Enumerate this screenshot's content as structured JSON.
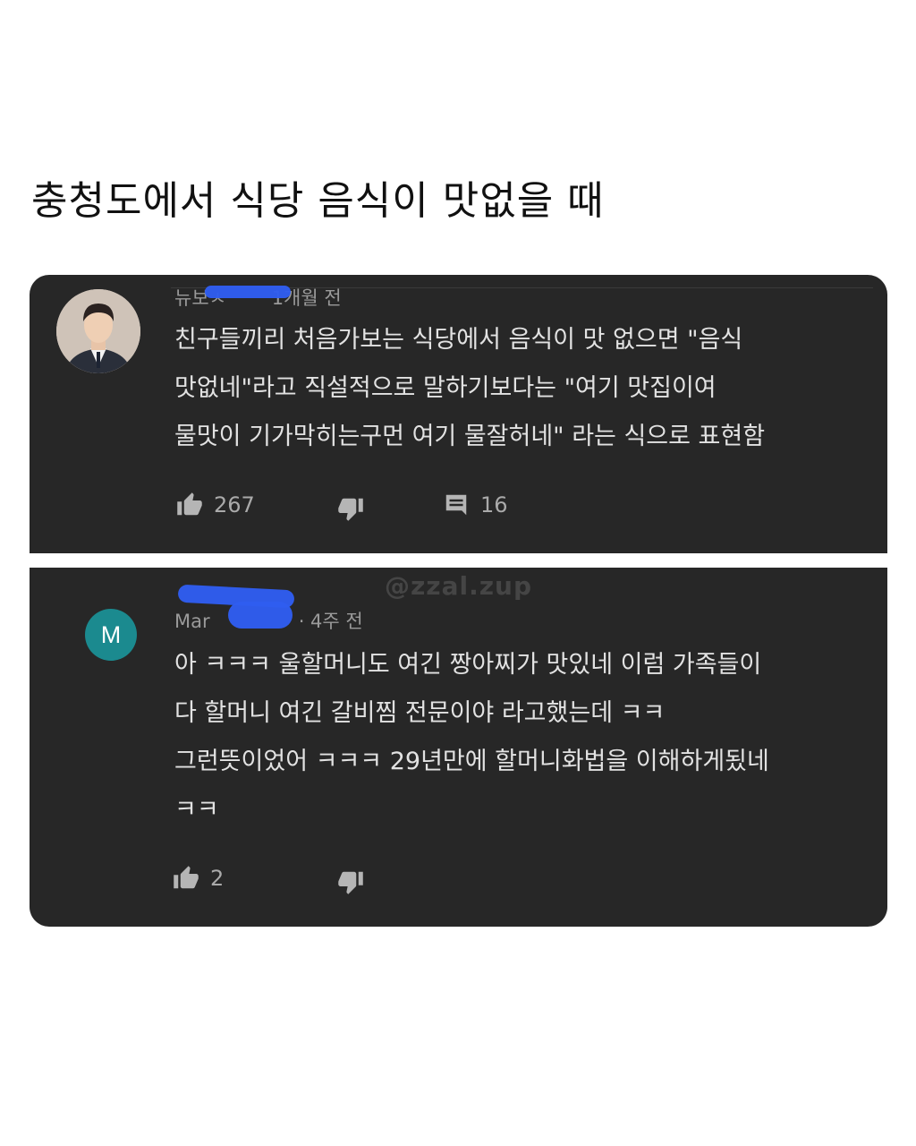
{
  "page": {
    "title": "충청도에서 식당 음식이 맛없을 때",
    "watermark": "@zzal.zup"
  },
  "comments": [
    {
      "author": "뉴보ㅅ",
      "time": "1개월 전",
      "lines": [
        "친구들끼리 처음가보는 식당에서 음식이 맛 없으면  \"음식",
        "맛없네\"라고 직설적으로 말하기보다는 \"여기 맛집이여",
        "물맛이 기가막히는구먼 여기 물잘허네\" 라는 식으로 표현함"
      ],
      "likes": "267",
      "replies": "16"
    },
    {
      "author": "Mar",
      "avatar_letter": "M",
      "time": "· 4주 전",
      "lines": [
        "아 ㅋㅋㅋ 울할머니도 여긴 짱아찌가 맛있네 이럼 가족들이",
        "다 할머니 여긴 갈비찜 전문이야 라고했는데 ㅋㅋ",
        "그런뜻이었어 ㅋㅋㅋ 29년만에 할머니화법을 이해하게됬네",
        "ㅋㅋ"
      ],
      "likes": "2"
    }
  ],
  "colors": {
    "card_bg": "#272727",
    "text": "#e2e2e2",
    "muted": "#9a9a9a",
    "redaction": "#2f5df0",
    "avatar_teal": "#1b8a8f"
  },
  "icons": {
    "like": "thumb-up-icon",
    "dislike": "thumb-down-icon",
    "reply": "comment-icon"
  }
}
